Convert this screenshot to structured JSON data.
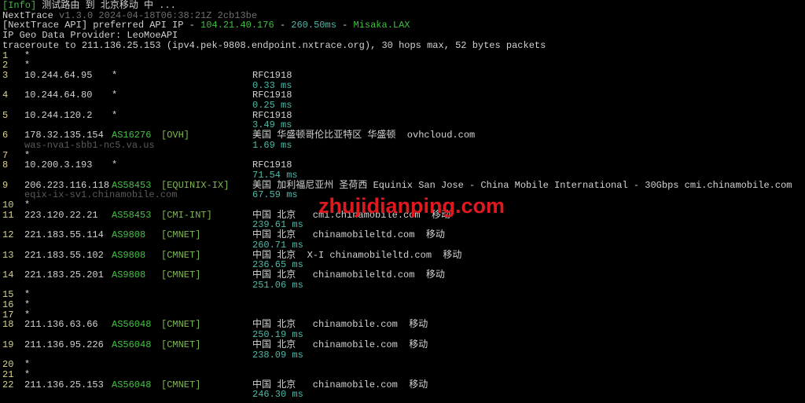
{
  "header_lines": [
    [
      {
        "text": "[Info]",
        "color": "green"
      },
      {
        "text": " 测试路由 到 北京移动 中 ...",
        "color": "default"
      }
    ],
    [
      {
        "text": "NextTrace",
        "color": "default"
      },
      {
        "text": " v1.3.0 2024-04-18T06:38:21Z 2cb13be",
        "color": "gray"
      }
    ],
    [
      {
        "text": "[NextTrace API] preferred API IP - ",
        "color": "default"
      },
      {
        "text": "104.21.40.176",
        "color": "green"
      },
      {
        "text": " - ",
        "color": "default"
      },
      {
        "text": "260.50ms",
        "color": "teal"
      },
      {
        "text": " - ",
        "color": "default"
      },
      {
        "text": "Misaka.LAX",
        "color": "green"
      }
    ],
    [
      {
        "text": "IP Geo Data Provider: LeoMoeAPI",
        "color": "default"
      }
    ],
    [
      {
        "text": "traceroute to 211.136.25.153 (ipv4.pek-9808.endpoint.nxtrace.org), 30 hops max, 52 bytes packets",
        "color": "default"
      }
    ]
  ],
  "hops": [
    {
      "hop": "1",
      "ip": "*"
    },
    {
      "hop": "2",
      "ip": "*"
    },
    {
      "hop": "3",
      "ip": "10.244.64.95",
      "asn": "*",
      "geo": "RFC1918",
      "rtt": "0.33 ms"
    },
    {
      "hop": "4",
      "ip": "10.244.64.80",
      "asn": "*",
      "geo": "RFC1918",
      "rtt": "0.25 ms"
    },
    {
      "hop": "5",
      "ip": "10.244.120.2",
      "asn": "*",
      "geo": "RFC1918",
      "rtt": "3.49 ms"
    },
    {
      "hop": "6",
      "ip": "178.32.135.154",
      "asn": "AS16276",
      "tag": "[OVH]",
      "geo": "美国 华盛顿哥伦比亚特区 华盛顿  ovhcloud.com",
      "host": "was-nva1-sbb1-nc5.va.us",
      "rtt": "1.69 ms"
    },
    {
      "hop": "7",
      "ip": "*"
    },
    {
      "hop": "8",
      "ip": "10.200.3.193",
      "asn": "*",
      "geo": "RFC1918",
      "rtt": "71.54 ms"
    },
    {
      "hop": "9",
      "ip": "206.223.116.118",
      "asn": "AS58453",
      "tag": "[EQUINIX-IX]",
      "geo": "美国 加利福尼亚州 圣荷西 Equinix San Jose - China Mobile International - 30Gbps cmi.chinamobile.com",
      "host": "eqix-ix-sv1.chinamobile.com",
      "rtt": "67.59 ms"
    },
    {
      "hop": "10",
      "ip": "*"
    },
    {
      "hop": "11",
      "ip": "223.120.22.21",
      "asn": "AS58453",
      "tag": "[CMI-INT]",
      "geo": "中国 北京   cmi.chinamobile.com  移动",
      "rtt": "239.61 ms"
    },
    {
      "hop": "12",
      "ip": "221.183.55.114",
      "asn": "AS9808",
      "tag": "[CMNET]",
      "geo": "中国 北京   chinamobileltd.com  移动",
      "rtt": "260.71 ms"
    },
    {
      "hop": "13",
      "ip": "221.183.55.102",
      "asn": "AS9808",
      "tag": "[CMNET]",
      "geo": "中国 北京  X-I chinamobileltd.com  移动",
      "rtt": "236.65 ms"
    },
    {
      "hop": "14",
      "ip": "221.183.25.201",
      "asn": "AS9808",
      "tag": "[CMNET]",
      "geo": "中国 北京   chinamobileltd.com  移动",
      "rtt": "251.06 ms"
    },
    {
      "hop": "15",
      "ip": "*"
    },
    {
      "hop": "16",
      "ip": "*"
    },
    {
      "hop": "17",
      "ip": "*"
    },
    {
      "hop": "18",
      "ip": "211.136.63.66",
      "asn": "AS56048",
      "tag": "[CMNET]",
      "geo": "中国 北京   chinamobile.com  移动",
      "rtt": "250.19 ms"
    },
    {
      "hop": "19",
      "ip": "211.136.95.226",
      "asn": "AS56048",
      "tag": "[CMNET]",
      "geo": "中国 北京   chinamobile.com  移动",
      "rtt": "238.09 ms"
    },
    {
      "hop": "20",
      "ip": "*"
    },
    {
      "hop": "21",
      "ip": "*"
    },
    {
      "hop": "22",
      "ip": "211.136.25.153",
      "asn": "AS56048",
      "tag": "[CMNET]",
      "geo": "中国 北京   chinamobile.com  移动",
      "rtt": "246.30 ms"
    }
  ],
  "watermark": "zhujidianping.com"
}
